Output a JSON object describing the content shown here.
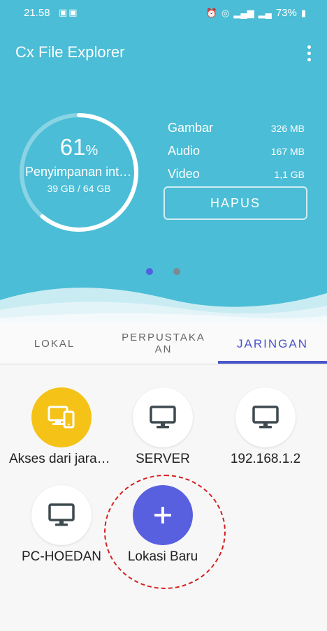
{
  "status_bar": {
    "time": "21.58",
    "battery": "73%"
  },
  "app": {
    "title": "Cx File Explorer"
  },
  "storage": {
    "percent": "61",
    "percent_sign": "%",
    "label": "Penyimpanan internal",
    "usage": "39 GB / 64 GB",
    "used_fraction": 0.61
  },
  "stats": [
    {
      "name": "Gambar",
      "value": "326 MB"
    },
    {
      "name": "Audio",
      "value": "167 MB"
    },
    {
      "name": "Video",
      "value": "1,1 GB"
    }
  ],
  "hapus_label": "HAPUS",
  "tabs": [
    {
      "label": "LOKAL"
    },
    {
      "label": "PERPUSTAKA AN"
    },
    {
      "label": "JARINGAN"
    }
  ],
  "locations": [
    {
      "name": "Akses dari jarak jauh",
      "icon": "remote-devices-icon"
    },
    {
      "name": "SERVER",
      "icon": "monitor-icon"
    },
    {
      "name": "192.168.1.2",
      "icon": "monitor-icon"
    },
    {
      "name": "PC-HOEDAN",
      "icon": "monitor-icon"
    },
    {
      "name": "Lokasi Baru",
      "icon": "plus-icon"
    }
  ],
  "colors": {
    "header_bg": "#4bbdd6",
    "accent": "#4a55c9",
    "remote_bg": "#f5c217",
    "add_bg": "#5860e0",
    "highlight": "#d42020"
  }
}
